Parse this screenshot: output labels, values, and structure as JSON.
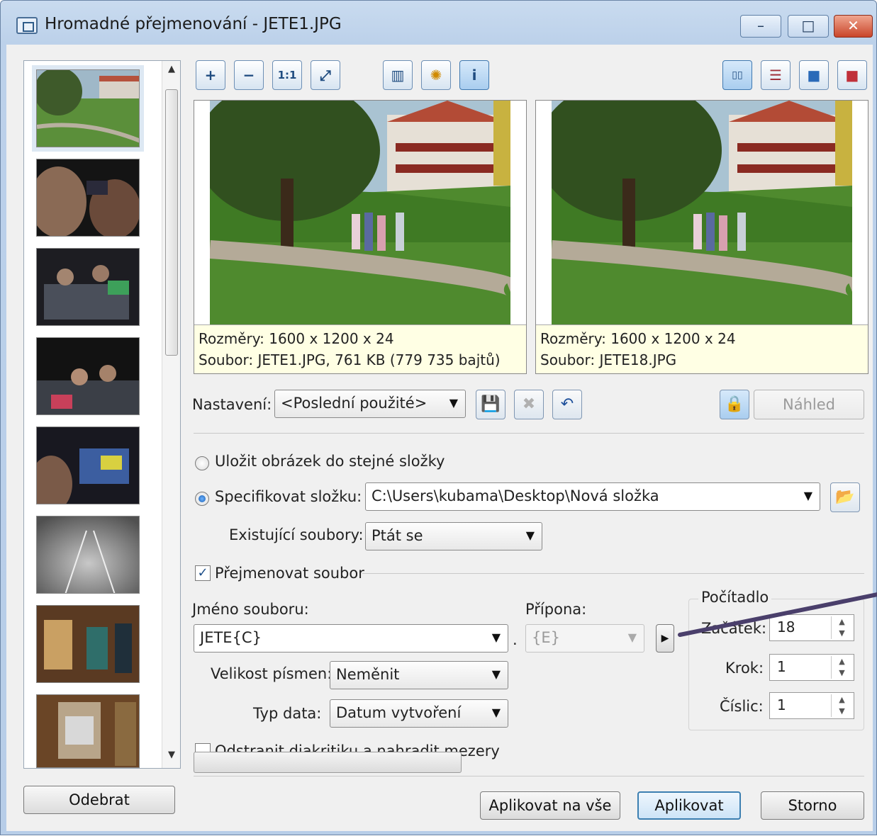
{
  "window": {
    "title": "Hromadné přejmenování - JETE1.JPG",
    "minimize_glyph": "–",
    "maximize_glyph": "□",
    "close_glyph": "✕"
  },
  "toolbar": {
    "zoom_in_glyph": "+",
    "zoom_out_glyph": "−",
    "actual_size_label": "1:1",
    "fit_glyph": "⤢",
    "histogram_glyph": "▥",
    "effects_glyph": "✺",
    "info_glyph": "i",
    "view_side_glyph": "▯▯",
    "view_stack_glyph": "☰",
    "view_single_glyph": "■",
    "view_single_red_glyph": "■"
  },
  "preview": {
    "left": {
      "dims": "Rozměry: 1600 x 1200 x 24",
      "file": "Soubor: JETE1.JPG, 761 KB (779 735 bajtů)"
    },
    "right": {
      "dims": "Rozměry: 1600 x 1200 x 24",
      "file": "Soubor: JETE18.JPG"
    }
  },
  "settings": {
    "label": "Nastavení:",
    "value": "<Poslední použité>",
    "save_glyph": "💾",
    "delete_glyph": "✖",
    "undo_glyph": "↶",
    "lock_glyph": "🔒",
    "preview_button": "Náhled"
  },
  "output": {
    "same_folder_label": "Uložit obrázek do stejné složky",
    "specify_label": "Specifikovat složku:",
    "folder_path": "C:\\Users\\kubama\\Desktop\\Nová složka",
    "browse_glyph": "📂",
    "existing_label": "Existující soubory:",
    "existing_value": "Ptát se",
    "same_folder_selected": false,
    "specify_selected": true
  },
  "rename": {
    "check_label": "Přejmenovat soubor",
    "check_mark": "✓",
    "filename_label": "Jméno souboru:",
    "filename_value": "JETE{C}",
    "dot": ".",
    "extension_label": "Přípona:",
    "extension_value": "{E}",
    "insert_glyph": "▶",
    "case_label": "Velikost písmen:",
    "case_value": "Neměnit",
    "date_label": "Typ data:",
    "date_value": "Datum vytvoření"
  },
  "counter": {
    "title": "Počítadlo",
    "start_label": "Začátek:",
    "start_value": "18",
    "step_label": "Krok:",
    "step_value": "1",
    "digits_label": "Číslic:",
    "digits_value": "1",
    "up_glyph": "▲",
    "down_glyph": "▼"
  },
  "options": {
    "diacritics_label": "Odstranit diakritiku a nahradit mezery"
  },
  "buttons": {
    "remove": "Odebrat",
    "apply_all": "Aplikovat na vše",
    "apply": "Aplikovat",
    "cancel": "Storno"
  },
  "scroll": {
    "up_glyph": "▲",
    "down_glyph": "▼"
  },
  "progress_fraction": 0.0,
  "colors": {
    "annotation_arrow": "#4a3f6b"
  }
}
